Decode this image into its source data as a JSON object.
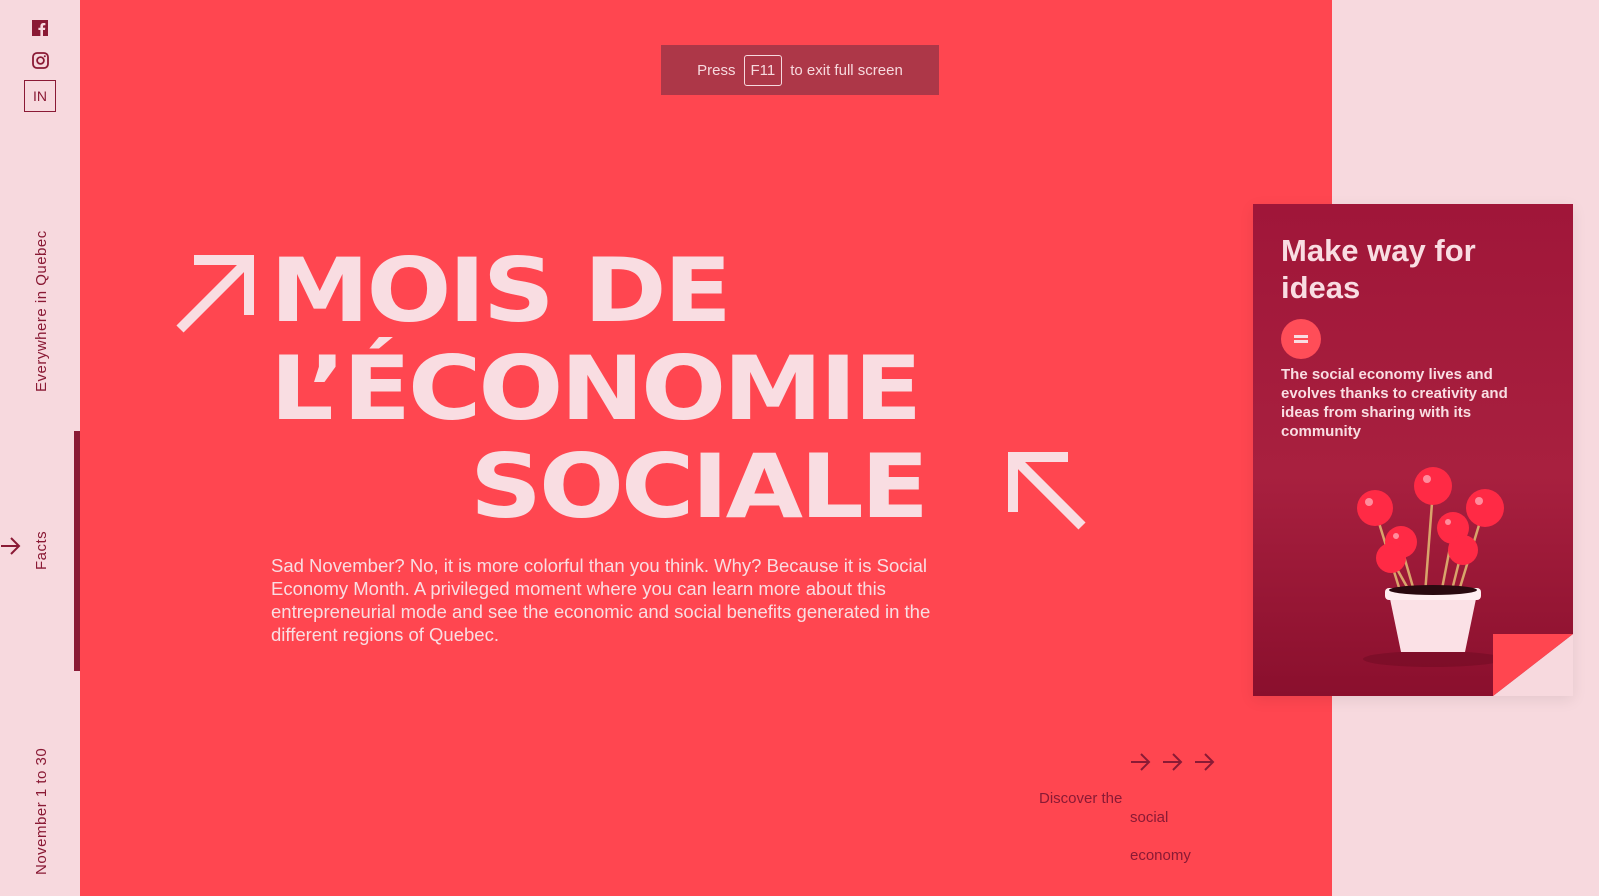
{
  "sidebar": {
    "social": {
      "facebook": "facebook-icon",
      "instagram": "instagram-icon",
      "linkedin_label": "IN"
    },
    "vertical_texts": {
      "everywhere": "Everywhere in Quebec",
      "facts": "Facts",
      "dates": "November 1 to 30"
    }
  },
  "fullscreen_notice": {
    "press": "Press",
    "key": "F11",
    "rest": "to exit full screen"
  },
  "hero": {
    "line1": "MOIS DE",
    "line2": "L’ÉCONOMIE",
    "line3": "SOCIALE",
    "intro": "Sad November? No, it is more colorful than you think. Why? Because it is Social Economy Month. A privileged moment where you can learn more about this entrepreneurial mode and see the economic and social benefits generated in the different regions of Quebec."
  },
  "discover": {
    "line1": "Discover the",
    "line2": "social",
    "line3": "economy"
  },
  "card": {
    "title": "Make way for ideas",
    "text": "The social economy lives and evolves thanks to creativity and ideas from sharing with its community",
    "badge_icon": "equals-icon"
  },
  "colors": {
    "main_bg": "#ff4650",
    "side_bg": "#f7d9de",
    "accent_dark": "#8a1a35",
    "text_light": "#f9dde2"
  }
}
